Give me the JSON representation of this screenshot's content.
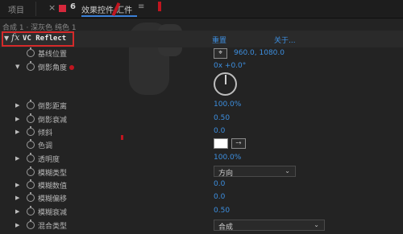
{
  "tabs": {
    "project": "项目",
    "close": "×",
    "effect_controls": "效果控件 汇件",
    "menu": "≡"
  },
  "breadcrumb": "合成 1 · 深灰色 纯色 1",
  "effect": {
    "icon": "fx",
    "name": "VC Reflect",
    "reset": "重置",
    "about": "关于..."
  },
  "properties": [
    {
      "label": "基线位置",
      "value": "960.0, 1080.0",
      "twirl": false
    },
    {
      "label": "倒影角度",
      "value": "0x +0.0°",
      "twirl": true,
      "expanded": true
    },
    {
      "label": "倒影距离",
      "value": "100.0%",
      "twirl": true
    },
    {
      "label": "倒影衰减",
      "value": "0.50",
      "twirl": true
    },
    {
      "label": "倾斜",
      "value": "0.0",
      "twirl": true
    },
    {
      "label": "色调",
      "value": "",
      "twirl": false
    },
    {
      "label": "透明度",
      "value": "100.0%",
      "twirl": true
    },
    {
      "label": "模糊类型",
      "value": "",
      "twirl": false
    },
    {
      "label": "模糊数值",
      "value": "0.0",
      "twirl": true
    },
    {
      "label": "模糊偏移",
      "value": "0.0",
      "twirl": true
    },
    {
      "label": "模糊衰减",
      "value": "0.50",
      "twirl": true
    },
    {
      "label": "混合类型",
      "value": "",
      "twirl": true
    }
  ],
  "dropdowns": {
    "blur_type": "方向",
    "blend_type": "合成"
  },
  "icons": {
    "twirl_open": "triangle-down-icon",
    "twirl_closed": "triangle-right-icon",
    "stopwatch": "stopwatch-icon",
    "crosshair": "crosshair-icon",
    "eyedropper": "eyedropper-icon"
  },
  "colors": {
    "accent_blue": "#3d8fe0",
    "highlight_red": "#d42a2a",
    "tint_swatch": "#ffffff"
  },
  "angle_dial_value_deg": 0
}
